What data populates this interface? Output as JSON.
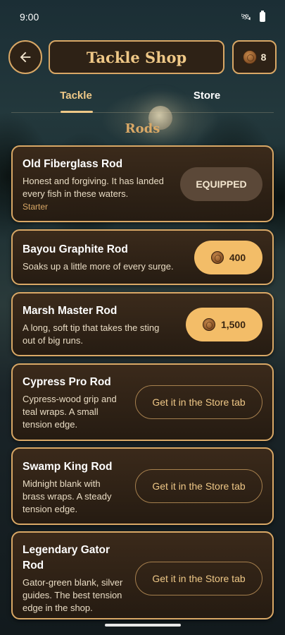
{
  "status_bar": {
    "time": "9:00",
    "icons": [
      "satellite-icon",
      "battery-icon"
    ]
  },
  "header": {
    "back_icon": "arrow-left-icon",
    "title": "Tackle Shop",
    "coin_balance": "8",
    "coin_icon": "coin-icon"
  },
  "tabs": [
    {
      "label": "Tackle",
      "selected": true
    },
    {
      "label": "Store",
      "selected": false
    }
  ],
  "section_title": "Rods",
  "rods": [
    {
      "name": "Old Fiberglass Rod",
      "desc_lines": [
        "Honest and forgiving. It has landed",
        "every fish in these waters."
      ],
      "tag": "Starter",
      "action_type": "equipped",
      "action_label": "EQUIPPED"
    },
    {
      "name": "Bayou Graphite Rod",
      "desc_lines": [
        "Soaks up a little more of every surge."
      ],
      "action_type": "buy",
      "price": "400"
    },
    {
      "name": "Marsh Master Rod",
      "desc_lines": [
        "A long, soft tip that takes the sting",
        "out of big runs."
      ],
      "action_type": "buy",
      "price": "1,500"
    },
    {
      "name": "Cypress Pro Rod",
      "desc_lines": [
        "Cypress-wood grip and",
        "teal wraps. A small",
        "tension edge."
      ],
      "action_type": "store",
      "action_label": "Get it in the Store tab"
    },
    {
      "name": "Swamp King Rod",
      "desc_lines": [
        "Midnight blank with",
        "brass wraps. A steady",
        "tension edge."
      ],
      "action_type": "store",
      "action_label": "Get it in the Store tab"
    },
    {
      "name_lines": [
        "Legendary Gator",
        "Rod"
      ],
      "desc_lines": [
        "Gator-green blank, silver",
        "guides. The best tension",
        "edge in the shop."
      ],
      "action_type": "store",
      "action_label": "Get it in the Store tab"
    }
  ],
  "colors": {
    "accent": "#d9a866",
    "gold_text": "#efc887",
    "buy_button": "#f3bd68",
    "equipped_button": "#5b4838"
  }
}
